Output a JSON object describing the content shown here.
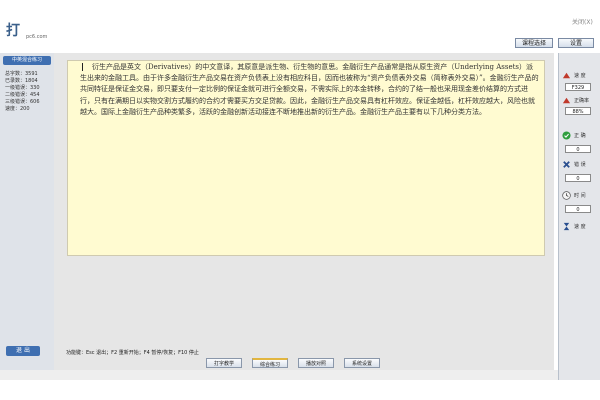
{
  "header": {
    "logo_text": "打",
    "logo_sub": "pc6.com",
    "close_label": "关闭(X)",
    "buttons": [
      "课程选择",
      "设置"
    ]
  },
  "sidebar": {
    "header_label": "中英混合练习",
    "stats": [
      "总字数：3591",
      "已录数：1804",
      "一级错误：330",
      "二级错误：454",
      "三级错误：606",
      "速度：200"
    ],
    "bottom_button": "退 出"
  },
  "content": {
    "paragraph": "衍生产品是英文（Derivatives）的中文意译，其原意是派生物、衍生物的意思。金融衍生产品通常是指从原生资产（Underlying Assets）派生出来的金融工具。由于许多金融衍生产品交易在资产负债表上没有相应科目，因而也被称为“资产负债表外交易（简称表外交易）”。金融衍生产品的共同特征是保证金交易，即只要支付一定比例的保证金就可进行全额交易，不需实际上的本金转移，合约的了结一般也采用现金差价结算的方式进行，只有在满期日以实物交割方式履约的合约才需要买方交足贷款。因此，金融衍生产品交易具有杠杆效应。保证金越低，杠杆效应越大，风险也就越大。国际上金融衍生产品种类繁多，活跃的金融创新活动接连不断地推出新的衍生产品。金融衍生产品主要有以下几种分类方法。"
  },
  "footer": {
    "hint": "功能键：Esc 退出；F2 重新开始；F4 暂停/恢复；F10 停止",
    "buttons": [
      "打字教学",
      "综合练习",
      "播放对照",
      "系统设置"
    ]
  },
  "rightbar": {
    "items": [
      {
        "label": "速 度",
        "value": "F329"
      },
      {
        "label": "正确率",
        "value": "88%"
      },
      {
        "label": "正 确",
        "value": "0"
      },
      {
        "label": "错 误",
        "value": "0"
      },
      {
        "label": "时 间",
        "value": "0"
      },
      {
        "label": "速 度",
        "value": ""
      }
    ]
  },
  "colors": {
    "accent": "#3f6fb1",
    "paper": "#fffbd1"
  }
}
